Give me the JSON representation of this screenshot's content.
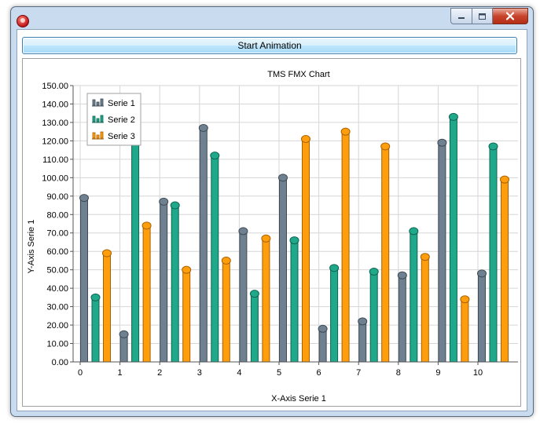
{
  "window": {
    "colors": {
      "frame": "#c9dbee",
      "close": "#c8442c"
    }
  },
  "button": {
    "label": "Start Animation"
  },
  "chart_data": {
    "type": "bar",
    "title": "TMS FMX Chart",
    "xlabel": "X-Axis Serie 1",
    "ylabel": "Y-Axis Serie 1",
    "ylim": [
      0,
      150
    ],
    "y_ticks": [
      "0.00",
      "10.00",
      "20.00",
      "30.00",
      "40.00",
      "50.00",
      "60.00",
      "70.00",
      "80.00",
      "90.00",
      "100.00",
      "110.00",
      "120.00",
      "130.00",
      "140.00",
      "150.00"
    ],
    "categories": [
      "0",
      "1",
      "2",
      "3",
      "4",
      "5",
      "6",
      "7",
      "8",
      "9",
      "10"
    ],
    "grid": true,
    "legend_position": "top-left",
    "series": [
      {
        "name": "Serie 1",
        "color": "#6f8090",
        "values": [
          89,
          15,
          87,
          127,
          71,
          100,
          18,
          22,
          47,
          119,
          48
        ]
      },
      {
        "name": "Serie 2",
        "color": "#1fa88a",
        "values": [
          35,
          126,
          85,
          112,
          37,
          66,
          51,
          49,
          71,
          133,
          117
        ]
      },
      {
        "name": "Serie 3",
        "color": "#ff9e0c",
        "values": [
          59,
          74,
          50,
          55,
          67,
          121,
          125,
          117,
          57,
          34,
          99
        ]
      }
    ]
  }
}
